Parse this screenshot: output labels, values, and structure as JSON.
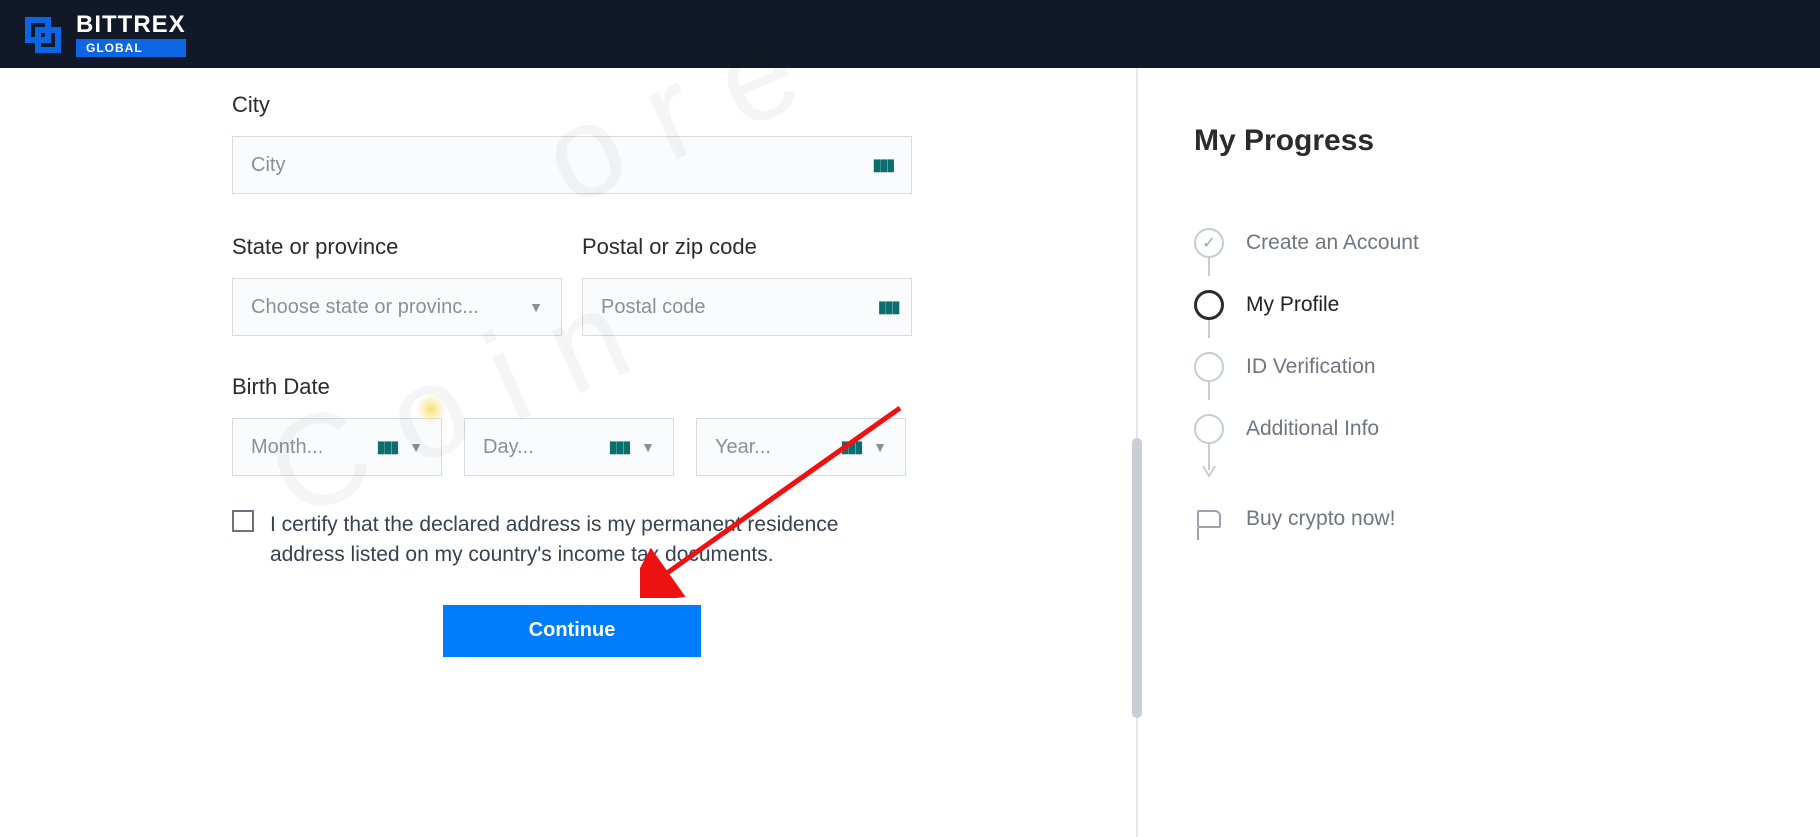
{
  "brand": {
    "name": "BITTREX",
    "sub": "GLOBAL"
  },
  "form": {
    "city_label": "City",
    "city_placeholder": "City",
    "state_label": "State or province",
    "state_placeholder": "Choose state or provinc...",
    "postal_label": "Postal or zip code",
    "postal_placeholder": "Postal code",
    "birth_label": "Birth Date",
    "month_placeholder": "Month...",
    "day_placeholder": "Day...",
    "year_placeholder": "Year...",
    "certify_text": "I certify that the declared address is my permanent residence address listed on my country's income tax documents.",
    "continue_label": "Continue"
  },
  "progress": {
    "title": "My Progress",
    "steps": [
      {
        "label": "Create an Account",
        "state": "done"
      },
      {
        "label": "My Profile",
        "state": "current"
      },
      {
        "label": "ID Verification",
        "state": "todo"
      },
      {
        "label": "Additional Info",
        "state": "todo"
      },
      {
        "label": "Buy crypto now!",
        "state": "final"
      }
    ]
  }
}
